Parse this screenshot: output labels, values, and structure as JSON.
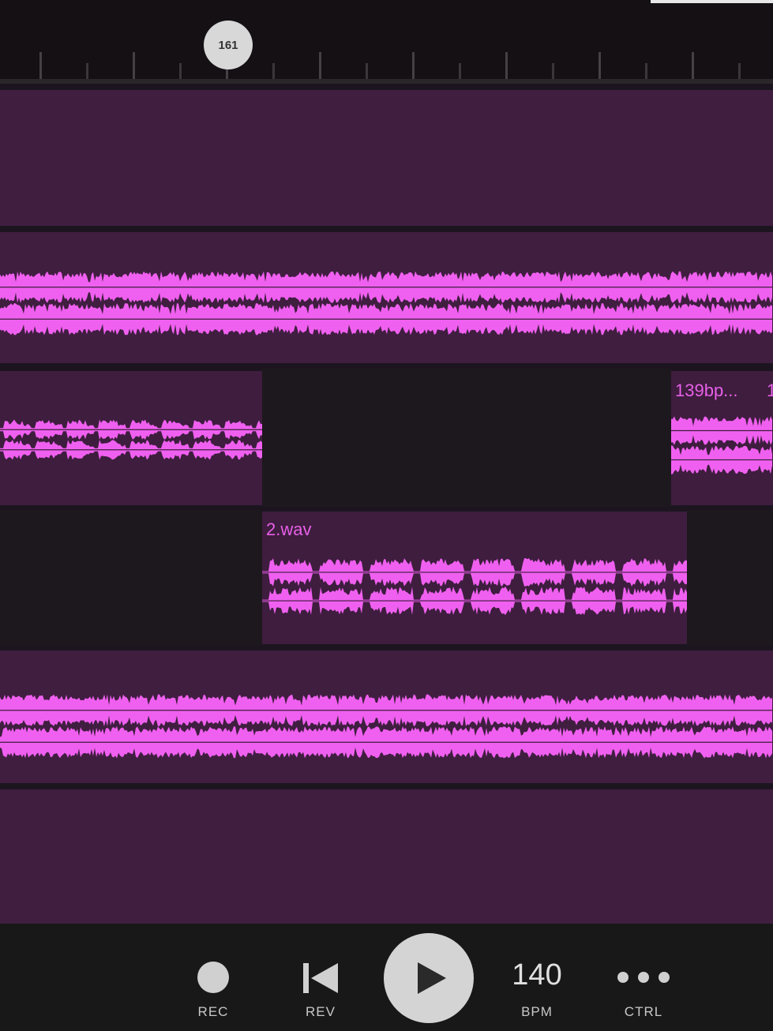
{
  "ruler": {
    "playhead_bar": "161"
  },
  "tracks": {
    "clip_3_label": "139bp...",
    "clip_3b_label": "1",
    "clip_4_label": "2.wav"
  },
  "transport": {
    "rec_label": "REC",
    "rev_label": "REV",
    "bpm_value": "140",
    "bpm_label": "BPM",
    "ctrl_label": "CTRL"
  },
  "colors": {
    "waveform": "#f060f0",
    "clip": "#3e1d3e",
    "empty_lane": "#1d181d",
    "transport_bg": "#181818"
  },
  "icons": {
    "rec": "record-circle-icon",
    "rev": "skip-back-icon",
    "play": "play-icon",
    "ctrl": "more-dots-icon"
  }
}
